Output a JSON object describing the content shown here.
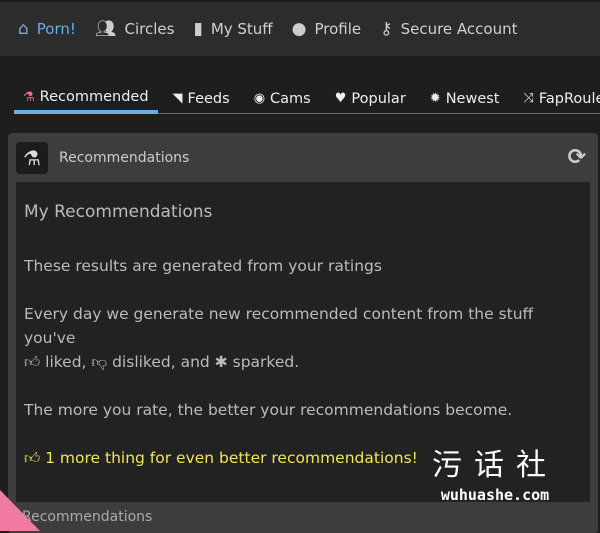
{
  "topnav": {
    "items": [
      {
        "label": "Porn!",
        "icon": "home-icon",
        "active": true
      },
      {
        "label": "Circles",
        "icon": "users-icon"
      },
      {
        "label": "My Stuff",
        "icon": "bookmark-icon"
      },
      {
        "label": "Profile",
        "icon": "user-icon"
      },
      {
        "label": "Secure Account",
        "icon": "key-icon"
      }
    ]
  },
  "tabs": [
    {
      "label": "Recommended",
      "icon": "flask-icon",
      "active": true
    },
    {
      "label": "Feeds",
      "icon": "rss-icon"
    },
    {
      "label": "Cams",
      "icon": "webcam-icon"
    },
    {
      "label": "Popular",
      "icon": "heart-icon"
    },
    {
      "label": "Newest",
      "icon": "certificate-icon"
    },
    {
      "label": "FapRoulette",
      "icon": "random-icon"
    }
  ],
  "panel": {
    "title": "Recommendations",
    "refresh_icon": "refresh-icon",
    "heading": "My Recommendations",
    "line1": "These results are generated from your ratings",
    "line2a": "Every day we generate new recommended content from the stuff you've",
    "liked": "liked,",
    "disliked": "disliked, and",
    "sparked": "sparked.",
    "line3": "The more you rate, the better your recommendations become.",
    "cta": "1 more thing for even better recommendations!",
    "cta_color": "#f2e35a"
  },
  "footer": {
    "label": "Recommendations"
  },
  "watermark": {
    "cn": "污话社",
    "en": "wuhuashe.com"
  },
  "colors": {
    "accent": "#6aaee8"
  }
}
